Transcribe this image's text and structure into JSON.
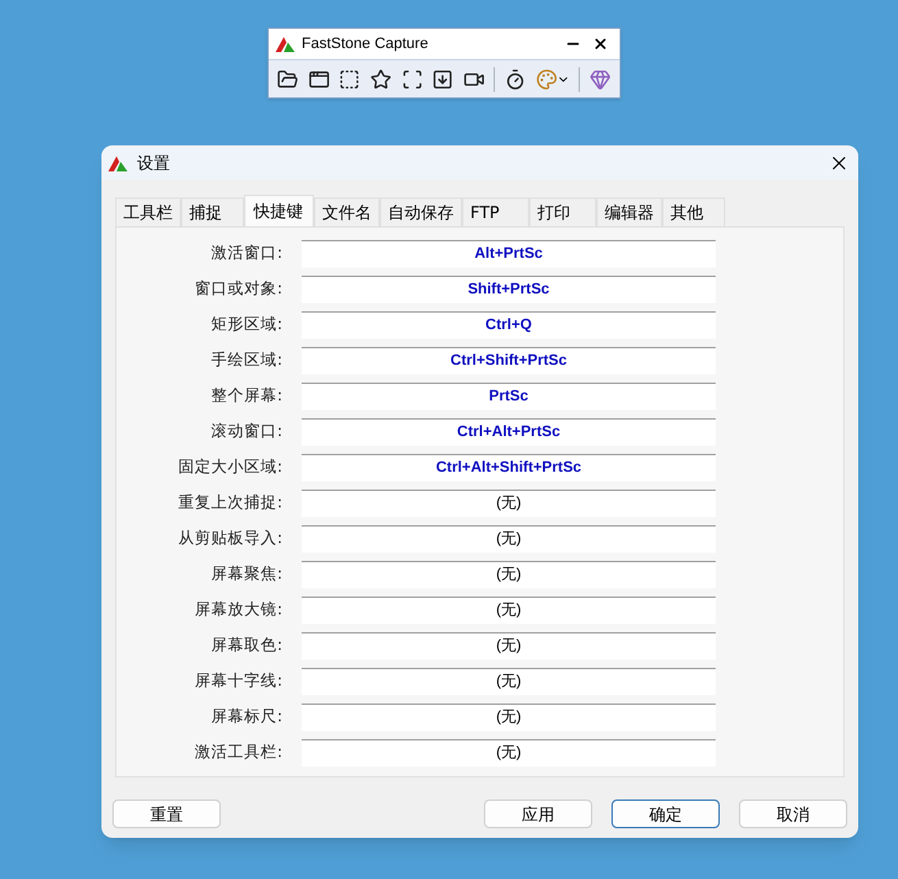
{
  "toolbar_window": {
    "title": "FastStone Capture"
  },
  "dialog": {
    "title": "设置",
    "tabs": [
      {
        "label": "工具栏",
        "selected": false
      },
      {
        "label": "捕捉",
        "selected": false
      },
      {
        "label": "快捷键",
        "selected": true
      },
      {
        "label": "文件名",
        "selected": false
      },
      {
        "label": "自动保存",
        "selected": false
      },
      {
        "label": "FTP",
        "selected": false
      },
      {
        "label": "打印",
        "selected": false
      },
      {
        "label": "编辑器",
        "selected": false
      },
      {
        "label": "其他",
        "selected": false
      }
    ],
    "hotkeys": [
      {
        "label": "激活窗口:",
        "value": "Alt+PrtSc",
        "kind": "shortcut"
      },
      {
        "label": "窗口或对象:",
        "value": "Shift+PrtSc",
        "kind": "shortcut"
      },
      {
        "label": "矩形区域:",
        "value": "Ctrl+Q",
        "kind": "shortcut"
      },
      {
        "label": "手绘区域:",
        "value": "Ctrl+Shift+PrtSc",
        "kind": "shortcut"
      },
      {
        "label": "整个屏幕:",
        "value": "PrtSc",
        "kind": "shortcut"
      },
      {
        "label": "滚动窗口:",
        "value": "Ctrl+Alt+PrtSc",
        "kind": "shortcut"
      },
      {
        "label": "固定大小区域:",
        "value": "Ctrl+Alt+Shift+PrtSc",
        "kind": "shortcut"
      },
      {
        "label": "重复上次捕捉:",
        "value": "(无)",
        "kind": "none"
      },
      {
        "label": "从剪贴板导入:",
        "value": "(无)",
        "kind": "none"
      },
      {
        "label": "屏幕聚焦:",
        "value": "(无)",
        "kind": "none"
      },
      {
        "label": "屏幕放大镜:",
        "value": "(无)",
        "kind": "none"
      },
      {
        "label": "屏幕取色:",
        "value": "(无)",
        "kind": "none"
      },
      {
        "label": "屏幕十字线:",
        "value": "(无)",
        "kind": "none"
      },
      {
        "label": "屏幕标尺:",
        "value": "(无)",
        "kind": "none"
      },
      {
        "label": "激活工具栏:",
        "value": "(无)",
        "kind": "none"
      }
    ],
    "buttons": [
      {
        "label": "重置",
        "kind": "normal"
      },
      {
        "label": "应用",
        "kind": "normal"
      },
      {
        "label": "确定",
        "kind": "default"
      },
      {
        "label": "取消",
        "kind": "normal"
      }
    ]
  }
}
